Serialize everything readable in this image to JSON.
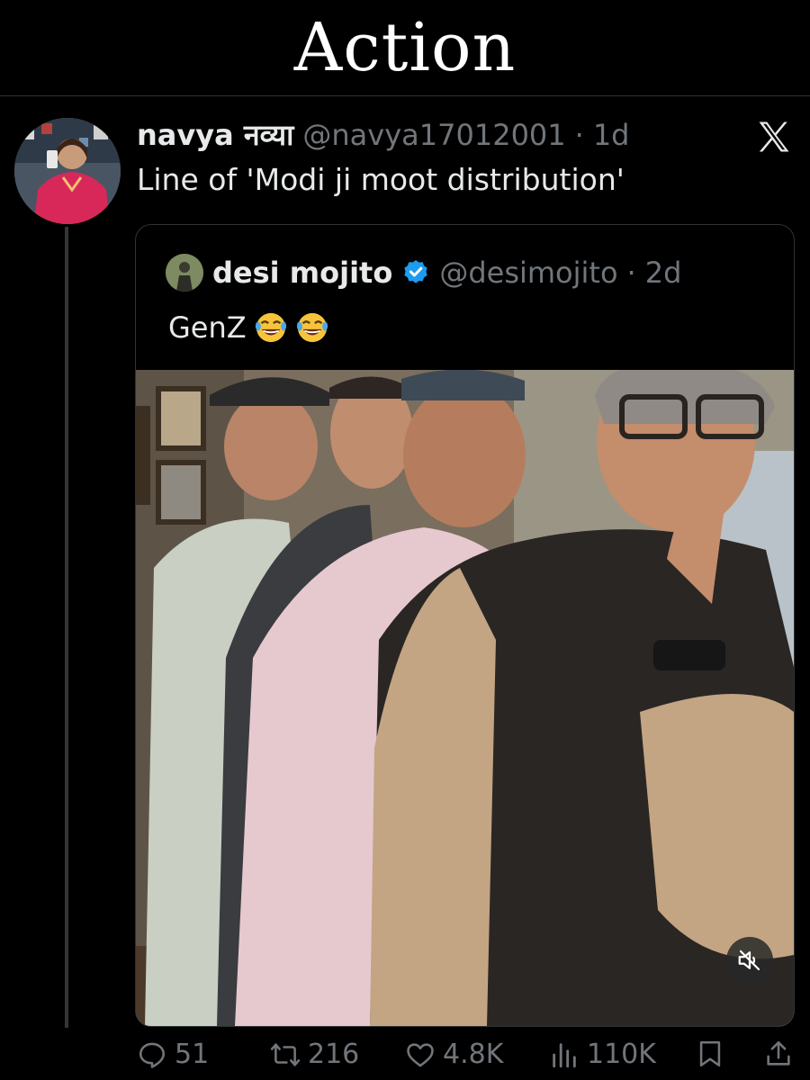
{
  "banner": {
    "title": "Action"
  },
  "tweet": {
    "display_name": "navya नव्या",
    "handle": "@navya17012001",
    "separator": "·",
    "time": "1d",
    "text": "Line of 'Modi ji moot distribution'"
  },
  "quote": {
    "display_name": "desi mojito",
    "verified": true,
    "handle": "@desimojito",
    "separator": "·",
    "time": "2d",
    "text": "GenZ",
    "emojis": [
      "face-with-tears-of-joy",
      "face-with-tears-of-joy"
    ]
  },
  "media": {
    "type": "video",
    "muted": true
  },
  "actions": {
    "replies": "51",
    "reposts": "216",
    "likes": "4.8K",
    "views": "110K"
  },
  "icons": [
    "x-logo-icon",
    "verified-badge-icon",
    "mute-icon",
    "reply-icon",
    "repost-icon",
    "like-icon",
    "views-icon",
    "bookmark-icon",
    "share-icon"
  ],
  "colors": {
    "background": "#000000",
    "text": "#e7e9ea",
    "secondary": "#71767b",
    "verified": "#1d9bf0",
    "border": "#2f3336"
  }
}
